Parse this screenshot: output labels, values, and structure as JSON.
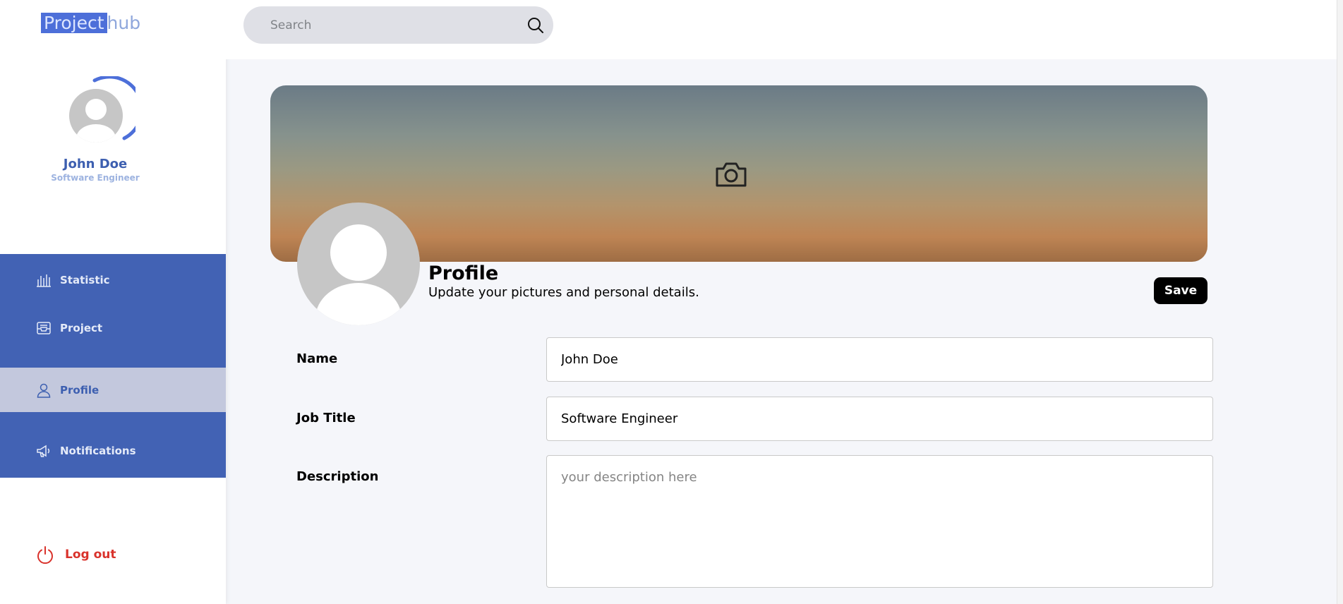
{
  "logo": {
    "part1": "Project",
    "part2": "hub"
  },
  "user": {
    "name": "John Doe",
    "title": "Software Engineer"
  },
  "nav": {
    "items": [
      {
        "label": "Statistic",
        "icon": "bar-chart-icon"
      },
      {
        "label": "Project",
        "icon": "inbox-icon"
      },
      {
        "label": "Profile",
        "icon": "user-icon",
        "active": true
      },
      {
        "label": "Notifications",
        "icon": "megaphone-icon"
      }
    ],
    "logout": "Log out"
  },
  "search": {
    "placeholder": "Search",
    "value": ""
  },
  "profile": {
    "title": "Profile",
    "subtitle": "Update your pictures and personal details.",
    "save_label": "Save"
  },
  "form": {
    "name": {
      "label": "Name",
      "value": "John Doe"
    },
    "job_title": {
      "label": "Job Title",
      "value": "Software Engineer"
    },
    "description": {
      "label": "Description",
      "value": "",
      "placeholder": "your description here"
    }
  },
  "colors": {
    "sidebar_nav": "#4262b4",
    "active_item": "#c3c8dd",
    "accent": "#3d5fb0",
    "logout": "#d9322b",
    "save_button": "#000000"
  }
}
